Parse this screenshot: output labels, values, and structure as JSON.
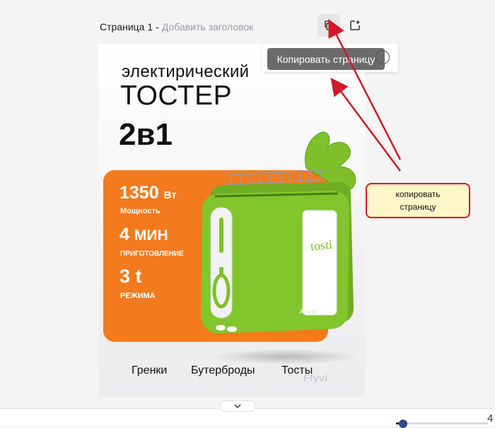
{
  "page": {
    "title": "Страница 1",
    "separator": "-",
    "add_title": "Добавить заголовок"
  },
  "toolbar": {
    "copy_icon": "copy-page-icon",
    "add_icon": "add-page-icon",
    "tooltip": "Копировать страницу"
  },
  "design": {
    "headline_1": "электирический",
    "headline_2": "ТОСТЕР",
    "headline_3": "2в1",
    "specs": [
      {
        "value": "1350",
        "unit": "Вт",
        "label": "Мощность"
      },
      {
        "value": "4",
        "unit": "МИН",
        "label": "ПРИГОТОВЛЕНИЕ"
      },
      {
        "value": "3",
        "unit": "t",
        "label": "РЕЖИМА"
      }
    ],
    "tags": [
      "Гренки",
      "Бутерброды",
      "Тосты"
    ],
    "watermark": "Flyvi",
    "toaster_brand": "tosti",
    "toaster_maker": "Ariete",
    "colors": {
      "accent": "#f37a1d",
      "toaster": "#7fc02a"
    }
  },
  "annotation": {
    "line_1": "копировать",
    "line_2": "страницу",
    "border_color": "#d0192a"
  },
  "zoom": {
    "value_visible": "4",
    "level": 0.08
  }
}
